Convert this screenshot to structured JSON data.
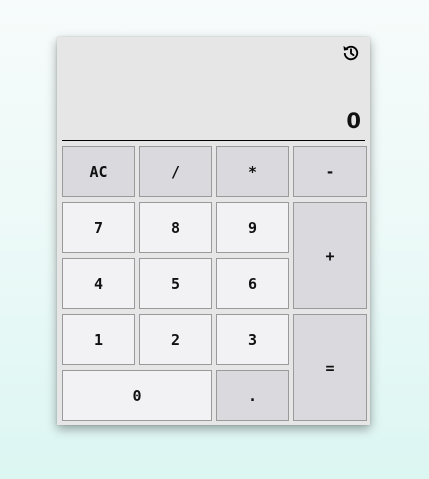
{
  "calculator": {
    "history_icon": "history-icon",
    "display_value": "0",
    "keys": {
      "clear": "AC",
      "divide": "/",
      "multiply": "*",
      "subtract": "-",
      "add": "+",
      "equals": "=",
      "decimal": ".",
      "d0": "0",
      "d1": "1",
      "d2": "2",
      "d3": "3",
      "d4": "4",
      "d5": "5",
      "d6": "6",
      "d7": "7",
      "d8": "8",
      "d9": "9"
    }
  }
}
